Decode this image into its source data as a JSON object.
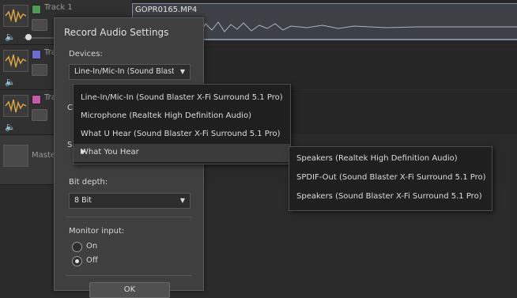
{
  "tracks": [
    {
      "name": "Track 1",
      "color": "#4f9a54"
    },
    {
      "name": "Tra",
      "color": "#6c6ccf"
    },
    {
      "name": "Tra",
      "color": "#c45aa8"
    },
    {
      "name": "Maste",
      "color": ""
    }
  ],
  "clip": {
    "title": "GOPR0165.MP4"
  },
  "dialog": {
    "title": "Record Audio Settings",
    "devices_label": "Devices:",
    "devices_value": "Line-In/Mic-In (Sound Blaster",
    "partial_label_1": "C",
    "partial_label_2": "S",
    "bit_depth_label": "Bit depth:",
    "bit_depth_value": "8 Bit",
    "monitor_label": "Monitor input:",
    "radio_on": "On",
    "radio_off": "Off",
    "ok": "OK"
  },
  "device_menu": [
    "Line-In/Mic-In (Sound Blaster X-Fi Surround 5.1 Pro)",
    "Microphone (Realtek High Definition Audio)",
    "What U Hear (Sound Blaster X-Fi Surround 5.1 Pro)",
    "What You Hear"
  ],
  "submenu": [
    "Speakers (Realtek High Definition Audio)",
    "SPDIF-Out (Sound Blaster X-Fi Surround 5.1 Pro)",
    "Speakers (Sound Blaster X-Fi Surround 5.1 Pro)"
  ],
  "icons": {
    "volume": "speaker-icon",
    "wave": "waveform-icon",
    "tool": "pencil-icon",
    "arrow": "dropdown-arrow-icon",
    "submenu": "submenu-arrow-icon"
  }
}
